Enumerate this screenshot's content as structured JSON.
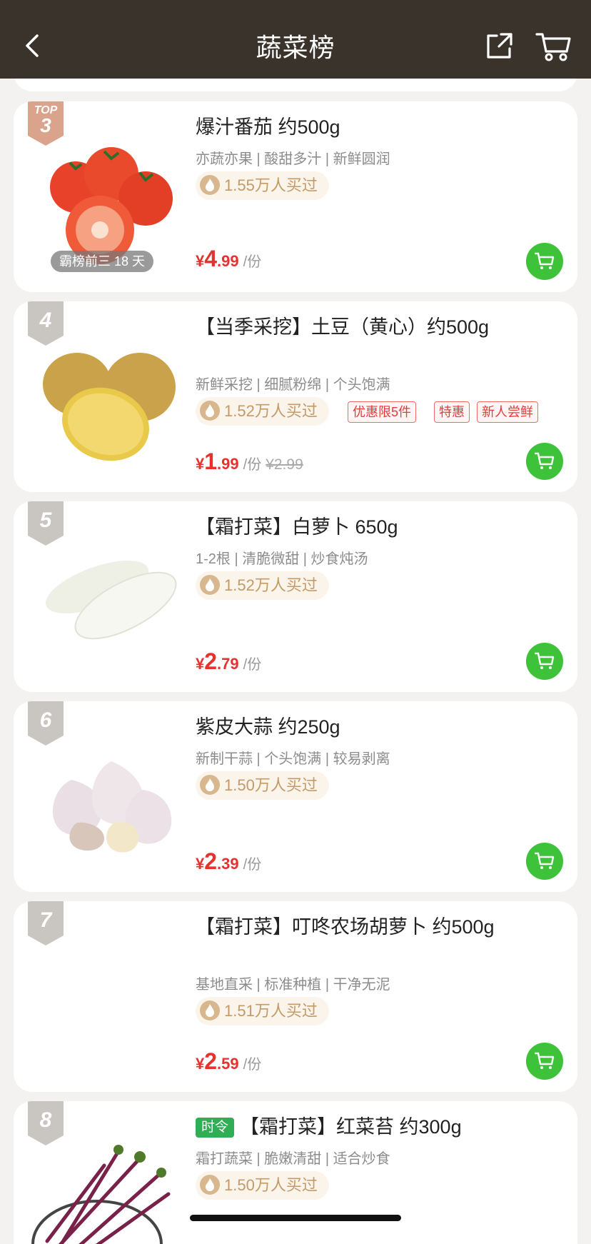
{
  "header": {
    "title": "蔬菜榜",
    "back_icon": "chevron-left-icon",
    "share_icon": "share-icon",
    "cart_icon": "shopping-cart-icon"
  },
  "colors": {
    "topbar": "#3a332c",
    "price": "#e6322e",
    "cart_button": "#3ec23a",
    "sales_text": "#c49a68"
  },
  "products": [
    {
      "rank_prefix": "TOP",
      "rank": "3",
      "badge": "霸榜前三 18 天",
      "name": "爆汁番茄 约500g",
      "subtitle": "亦蔬亦果 | 酸甜多汁 | 新鲜圆润",
      "sales": "1.55万人买过",
      "currency": "¥",
      "price_int": "4",
      "price_dec": ".99",
      "unit": "/份",
      "image": "tomato"
    },
    {
      "rank": "4",
      "name": "【当季采挖】土豆（黄心）约500g",
      "subtitle": "新鲜采挖 | 细腻粉绵 | 个头饱满",
      "sales": "1.52万人买过",
      "tags": [
        "优惠限5件",
        "特惠",
        "新人尝鲜"
      ],
      "currency": "¥",
      "price_int": "1",
      "price_dec": ".99",
      "unit": "/份",
      "old_price": "¥2.99",
      "image": "potato"
    },
    {
      "rank": "5",
      "name": "【霜打菜】白萝卜 650g",
      "subtitle": "1-2根 | 清脆微甜 | 炒食炖汤",
      "sales": "1.52万人买过",
      "currency": "¥",
      "price_int": "2",
      "price_dec": ".79",
      "unit": "/份",
      "image": "radish"
    },
    {
      "rank": "6",
      "name": "紫皮大蒜 约250g",
      "subtitle": "新制干蒜 | 个头饱满 | 较易剥离",
      "sales": "1.50万人买过",
      "currency": "¥",
      "price_int": "2",
      "price_dec": ".39",
      "unit": "/份",
      "image": "garlic"
    },
    {
      "rank": "7",
      "name": "【霜打菜】叮咚农场胡萝卜 约500g",
      "subtitle": "基地直采 | 标准种植 | 干净无泥",
      "sales": "1.51万人买过",
      "currency": "¥",
      "price_int": "2",
      "price_dec": ".59",
      "unit": "/份",
      "image": ""
    },
    {
      "rank": "8",
      "season_tag": "时令",
      "name": "【霜打菜】红菜苔 约300g",
      "subtitle": "霜打蔬菜 | 脆嫩清甜 | 适合炒食",
      "sales": "1.50万人买过",
      "image": "red-choy-sum"
    }
  ]
}
